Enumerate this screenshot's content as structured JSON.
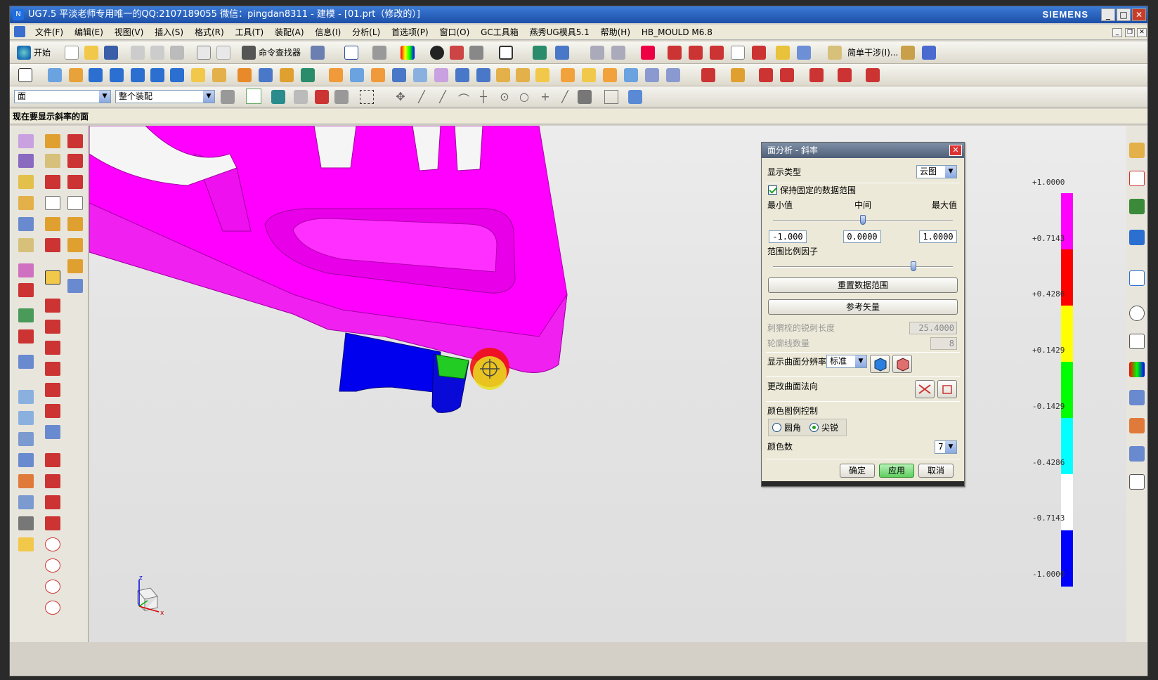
{
  "window": {
    "title": "UG7.5 平淡老师专用唯一的QQ:2107189055  微信：pingdan8311 - 建模 - [01.prt（修改的）]",
    "brand": "SIEMENS",
    "min_label": "_",
    "max_label": "□",
    "close_label": "✕"
  },
  "menu": {
    "items": [
      "文件(F)",
      "编辑(E)",
      "视图(V)",
      "插入(S)",
      "格式(R)",
      "工具(T)",
      "装配(A)",
      "信息(I)",
      "分析(L)",
      "首选项(P)",
      "窗口(O)",
      "GC工具箱",
      "燕秀UG模具5.1",
      "帮助(H)",
      "HB_MOULD M6.8"
    ]
  },
  "toolbar1": {
    "start_label": "开始",
    "command_finder_label": "命令查找器",
    "simple_interference_label": "简单干涉(I)..."
  },
  "selection": {
    "filter_value": "面",
    "scope_value": "整个装配"
  },
  "status": {
    "prompt": "现在要显示斜率的面"
  },
  "dialog": {
    "title": "面分析 - 斜率",
    "display_type_label": "显示类型",
    "display_type_value": "云图",
    "keep_fixed_range_label": "保持固定的数据范围",
    "keep_fixed_range_checked": true,
    "min_label": "最小值",
    "mid_label": "中间",
    "max_label": "最大值",
    "min_value": "-1.000",
    "mid_value": "0.0000",
    "max_value": "1.0000",
    "mid_slider_fraction": 0.5,
    "range_scale_label": "范围比例因子",
    "range_scale_fraction": 0.78,
    "reset_range_label": "重置数据范围",
    "ref_vector_label": "参考矢量",
    "hedgehog_len_label": "刺猬梳的锐刺长度",
    "hedgehog_len_value": "25.4000",
    "contour_count_label": "轮廓线数量",
    "contour_count_value": "8",
    "resolution_label": "显示曲面分辨率",
    "resolution_value": "标准",
    "change_normal_label": "更改曲面法向",
    "legend_control_label": "颜色图例控制",
    "legend_round_label": "圆角",
    "legend_sharp_label": "尖锐",
    "legend_selected": "sharp",
    "color_count_label": "颜色数",
    "color_count_value": "7",
    "ok_label": "确定",
    "apply_label": "应用",
    "cancel_label": "取消"
  },
  "legend": {
    "ticks": [
      "+1.0000",
      "+0.7143",
      "+0.4286",
      "+0.1429",
      "-0.1429",
      "-0.4286",
      "-0.7143",
      "-1.0000"
    ],
    "colors": [
      "#ff00ff",
      "#ff0000",
      "#ffff00",
      "#00ff00",
      "#00ffff",
      "#ffffff",
      "#0000ff"
    ]
  },
  "colors": {
    "magenta": "#ff00ff",
    "blue": "#0000ee",
    "green": "#22cc22",
    "apply_button": "#5fcf5f"
  },
  "coordsys": {
    "x_label": "x",
    "z_label": "z"
  }
}
